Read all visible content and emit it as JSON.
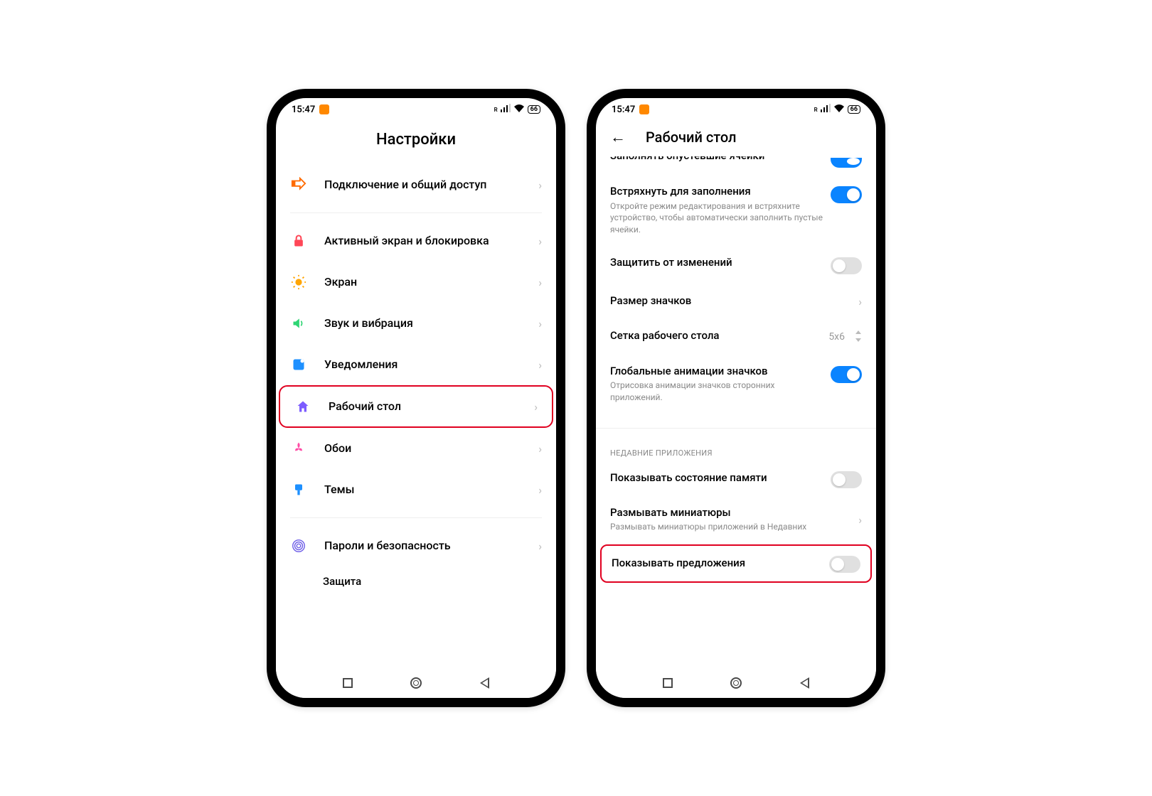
{
  "status": {
    "time": "15:47",
    "signal_badge": "R",
    "battery": "66"
  },
  "phone1": {
    "title": "Настройки",
    "items": [
      {
        "label": "Подключение и общий доступ",
        "icon": "share",
        "color": "#ff6b00"
      },
      {
        "label": "Активный экран и блокировка",
        "icon": "lock",
        "color": "#ff4757"
      },
      {
        "label": "Экран",
        "icon": "sun",
        "color": "#ffa502"
      },
      {
        "label": "Звук и вибрация",
        "icon": "sound",
        "color": "#2ed573"
      },
      {
        "label": "Уведомления",
        "icon": "notif",
        "color": "#1e90ff"
      },
      {
        "label": "Рабочий стол",
        "icon": "home",
        "color": "#7c5cff",
        "highlighted": true
      },
      {
        "label": "Обои",
        "icon": "flower",
        "color": "#ff4da6"
      },
      {
        "label": "Темы",
        "icon": "brush",
        "color": "#1e90ff"
      },
      {
        "label": "Пароли и безопасность",
        "icon": "fingerprint",
        "color": "#6c5ce7"
      }
    ],
    "cutoff_prefix": "Защита"
  },
  "phone2": {
    "title": "Рабочий стол",
    "partial_top": "Заполнять опустевшие ячейки",
    "rows": [
      {
        "title": "Встряхнуть для заполнения",
        "sub": "Откройте режим редактирования и встряхните устройство, чтобы автоматически заполнить пустые ячейки.",
        "toggle": "on"
      },
      {
        "title": "Защитить от изменений",
        "toggle": "off"
      },
      {
        "title": "Размер значков",
        "chevron": true
      },
      {
        "title": "Сетка рабочего стола",
        "value": "5x6",
        "updown": true
      },
      {
        "title": "Глобальные анимации значков",
        "sub": "Отрисовка анимации значков сторонних приложений.",
        "toggle": "on"
      }
    ],
    "section": "НЕДАВНИЕ ПРИЛОЖЕНИЯ",
    "recent_rows": [
      {
        "title": "Показывать состояние памяти",
        "toggle": "off"
      },
      {
        "title": "Размывать миниатюры",
        "sub": "Размывать миниатюры приложений в Недавних",
        "chevron": true
      },
      {
        "title": "Показывать предложения",
        "toggle": "off",
        "highlighted": true
      }
    ]
  }
}
